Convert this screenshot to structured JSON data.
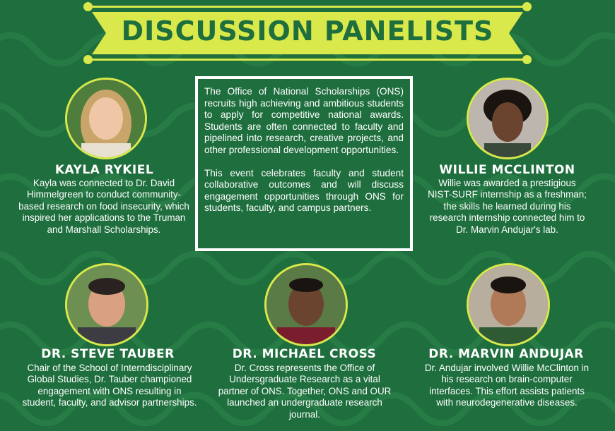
{
  "banner": {
    "title": "DISCUSSION PANELISTS"
  },
  "intro": {
    "paragraph1": "The Office of National Scholarships (ONS) recruits high achieving and ambitious students to apply for competitive national awards. Students are often connected to faculty and pipelined into research, creative projects, and other professional development opportunities.",
    "paragraph2": "This event celebrates faculty and student collaborative outcomes and will discuss engagement opportunities through ONS for students, faculty, and campus partners."
  },
  "panelists": [
    {
      "name": "KAYLA RYKIEL",
      "bio": "Kayla was connected to Dr. David Himmelgreen to conduct community-based research on food insecurity, which inspired her applications to the Truman and Marshall Scholarships."
    },
    {
      "name": "WILLIE MCCLINTON",
      "bio": "Willie was awarded a prestigious NIST-SURF internship as a freshman; the skills he learned during his research internship connected him to Dr. Marvin Andujar's lab."
    },
    {
      "name": "DR. STEVE TAUBER",
      "bio": "Chair of the School of Interndisciplinary Global Studies, Dr. Tauber championed engagement with ONS resulting in student, faculty, and advisor partnerships."
    },
    {
      "name": "DR. MICHAEL CROSS",
      "bio": "Dr. Cross represents the Office of Undersgraduate Research as a vital partner of ONS. Together, ONS and OUR launched an undergraduate research journal."
    },
    {
      "name": "DR. MARVIN ANDUJAR",
      "bio": "Dr. Andujar involved Willie McClinton in his research on brain-computer interfaces. This effort assists patients with neurodegenerative diseases."
    }
  ],
  "colors": {
    "background": "#1e6e3e",
    "accent": "#d9e84a",
    "text": "#ffffff"
  }
}
